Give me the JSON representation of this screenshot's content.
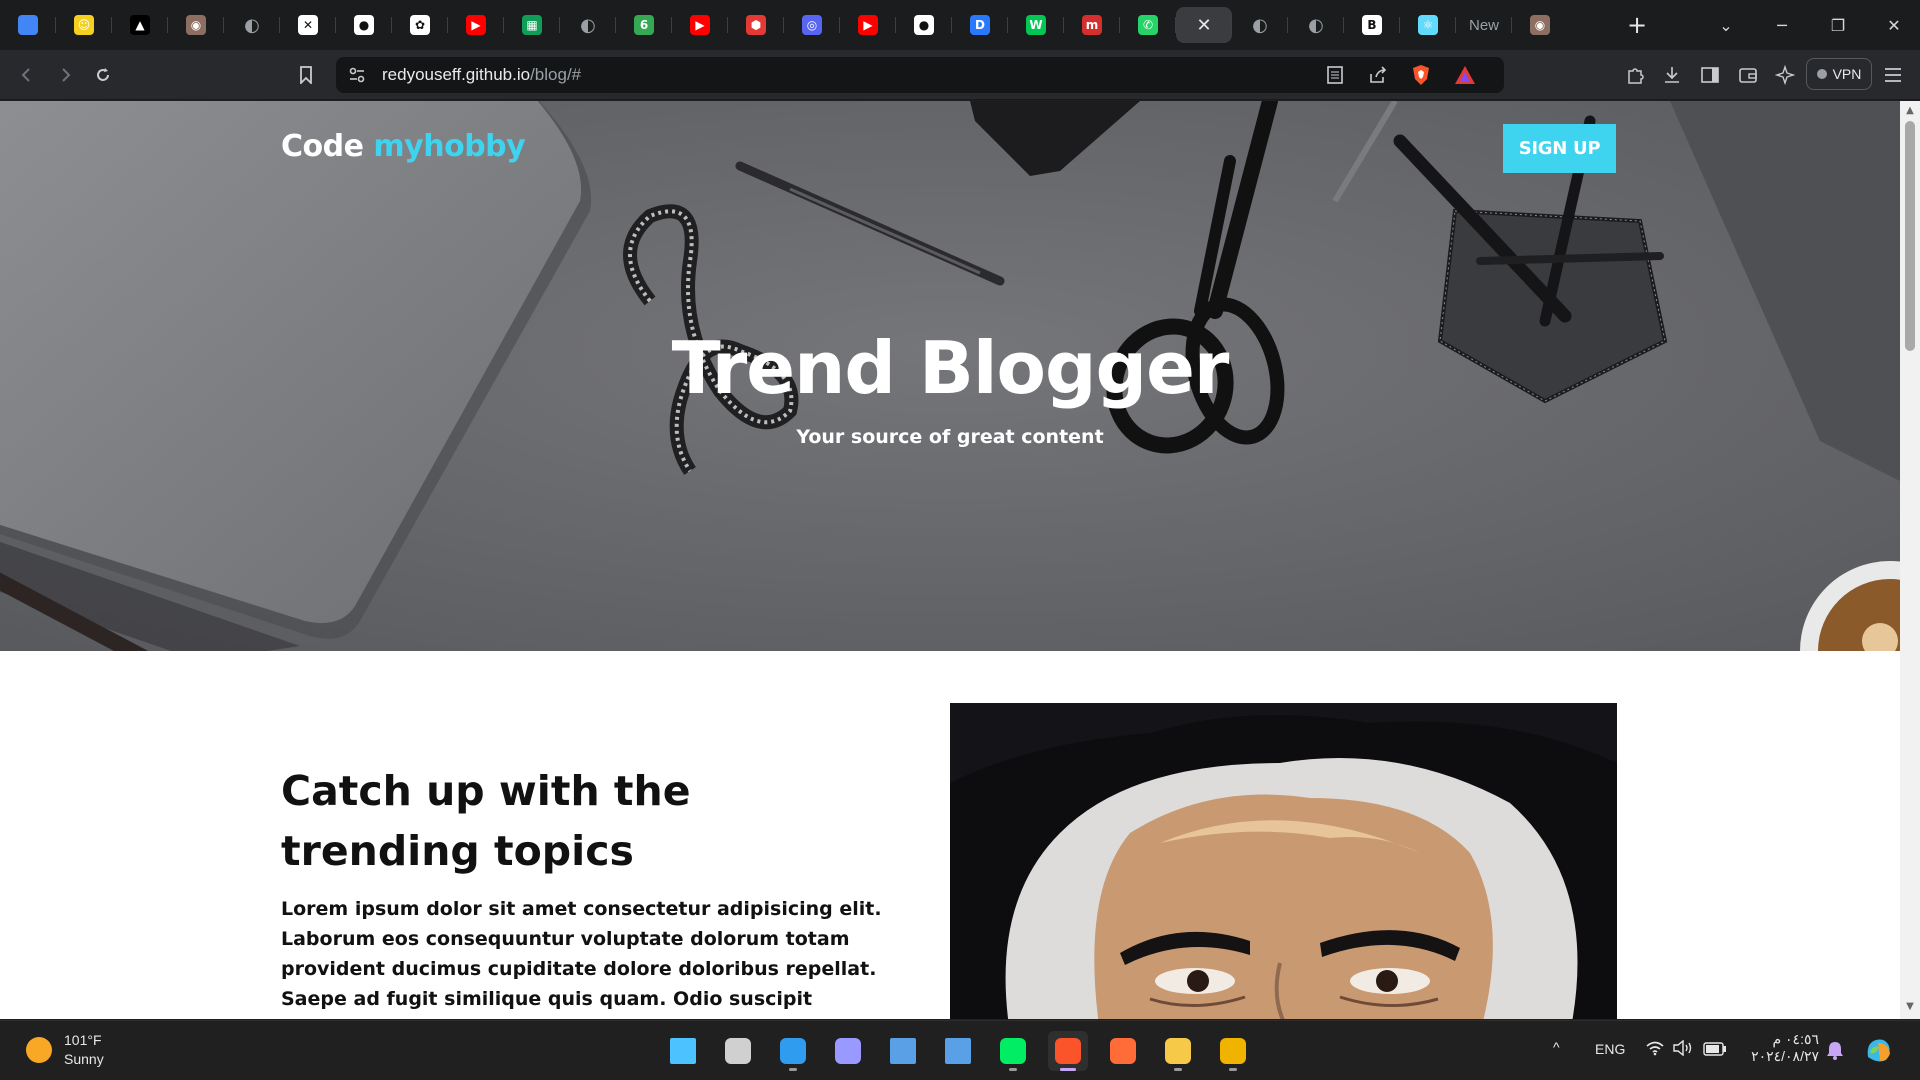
{
  "browser": {
    "tabs": [
      {
        "icon": "bar-chart-icon",
        "color": "#4285f4",
        "glyph": ""
      },
      {
        "icon": "smiley-icon",
        "color": "#f5d020",
        "glyph": "☺"
      },
      {
        "icon": "triangle-logo-icon",
        "color": "#000000",
        "glyph": "▲"
      },
      {
        "icon": "owl-icon",
        "color": "#8d6e63",
        "glyph": "◉"
      },
      {
        "icon": "globe-icon",
        "color": "#9aa0a6",
        "glyph": "◐"
      },
      {
        "icon": "puzzle-icon",
        "color": "#ffffff",
        "glyph": "✕"
      },
      {
        "icon": "github-icon",
        "color": "#ffffff",
        "glyph": "●"
      },
      {
        "icon": "openai-icon",
        "color": "#ffffff",
        "glyph": "✿"
      },
      {
        "icon": "youtube-icon",
        "color": "#ff0000",
        "glyph": "▶"
      },
      {
        "icon": "sheet-icon",
        "color": "#0f9d58",
        "glyph": "▦"
      },
      {
        "icon": "globe-icon",
        "color": "#9aa0a6",
        "glyph": "◐"
      },
      {
        "icon": "leaf-icon",
        "color": "#34a853",
        "glyph": "6"
      },
      {
        "icon": "youtube-icon",
        "color": "#ff0000",
        "glyph": "▶"
      },
      {
        "icon": "hexagon-icon",
        "color": "#e53935",
        "glyph": "⬢"
      },
      {
        "icon": "discord-icon",
        "color": "#5865f2",
        "glyph": "◎"
      },
      {
        "icon": "youtube-icon",
        "color": "#ff0000",
        "glyph": "▶"
      },
      {
        "icon": "github-icon",
        "color": "#ffffff",
        "glyph": "●"
      },
      {
        "icon": "d-logo-icon",
        "color": "#2979ff",
        "glyph": "D"
      },
      {
        "icon": "w-logo-icon",
        "color": "#00c853",
        "glyph": "W"
      },
      {
        "icon": "m-logo-icon",
        "color": "#d32f2f",
        "glyph": "m"
      },
      {
        "icon": "whatsapp-icon",
        "color": "#25d366",
        "glyph": "✆"
      },
      {
        "icon": "close-icon",
        "color": "",
        "glyph": "✕",
        "active": true
      },
      {
        "icon": "globe-icon",
        "color": "#9aa0a6",
        "glyph": "◐"
      },
      {
        "icon": "globe-icon",
        "color": "#9aa0a6",
        "glyph": "◐"
      },
      {
        "icon": "b-logo-icon",
        "color": "#ffffff",
        "glyph": "B"
      },
      {
        "icon": "react-icon",
        "color": "#61dafb",
        "glyph": "⚛"
      },
      {
        "icon": "newtab-icon",
        "color": "",
        "glyph": "",
        "text": "New"
      },
      {
        "icon": "owl-icon",
        "color": "#8d6e63",
        "glyph": "◉"
      }
    ],
    "url_host": "redyouseff.github.io",
    "url_path": "/blog/#",
    "vpn_label": "VPN"
  },
  "site": {
    "logo_main": "Code",
    "logo_accent": "myhobby",
    "accent_color": "#3ed3ee",
    "signup_label": "SIGN UP",
    "hero_title": "Trend Blogger",
    "hero_subtitle": "Your source of great content",
    "section_title": "Catch up with the trending topics",
    "section_body": "Lorem ipsum dolor sit amet consectetur adipisicing elit. Laborum eos consequuntur voluptate dolorum totam provident ducimus cupiditate dolore doloribus repellat. Saepe ad fugit similique quis quam. Odio suscipit incidunt"
  },
  "taskbar": {
    "weather_temp": "101°F",
    "weather_cond": "Sunny",
    "language": "ENG",
    "clock_time": "٠٤:٥٦ م",
    "clock_date": "٢٠٢٤/٠٨/٢٧",
    "apps": [
      {
        "name": "windows-start-icon",
        "color": "#4cc2ff"
      },
      {
        "name": "task-view-icon",
        "color": "#d0d0d0"
      },
      {
        "name": "vscode-icon",
        "color": "#2f9cf0"
      },
      {
        "name": "premiere-pro-icon",
        "color": "#9999ff"
      },
      {
        "name": "window-app-icon",
        "color": "#5aa0e6"
      },
      {
        "name": "window-app-icon",
        "color": "#5aa0e6"
      },
      {
        "name": "mongodb-compass-icon",
        "color": "#00ed64"
      },
      {
        "name": "brave-icon",
        "color": "#fb542b"
      },
      {
        "name": "postman-icon",
        "color": "#ff6c37"
      },
      {
        "name": "file-explorer-icon",
        "color": "#f7c948"
      },
      {
        "name": "brave-beta-icon",
        "color": "#f0b400"
      }
    ]
  }
}
